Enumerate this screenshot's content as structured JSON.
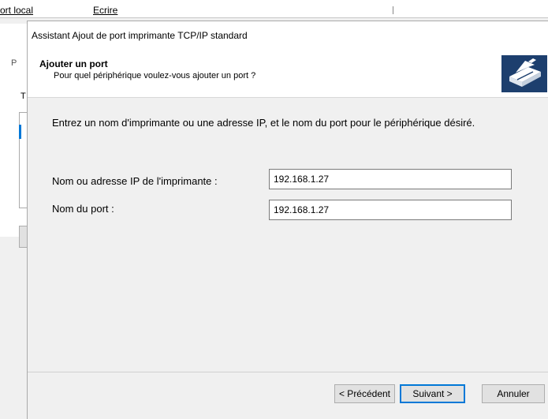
{
  "background_window": {
    "tab1": "ort local",
    "tab2": "Ecrire",
    "panel_p": "P",
    "panel_t": "T"
  },
  "dialog": {
    "title": "Assistant Ajout de port imprimante TCP/IP standard",
    "header": {
      "title": "Ajouter un port",
      "subtitle": "Pour quel périphérique voulez-vous ajouter un port ?",
      "icon": "printer-port-icon"
    },
    "instruction": "Entrez un nom d'imprimante ou une adresse IP, et le nom du port pour le périphérique désiré.",
    "fields": {
      "ip_label": "Nom ou adresse IP de l'imprimante :",
      "ip_value": "192.168.1.27",
      "port_label": "Nom du port :",
      "port_value": "192.168.1.27"
    },
    "buttons": {
      "back": "< Précédent",
      "next": "Suivant >",
      "cancel": "Annuler"
    }
  }
}
